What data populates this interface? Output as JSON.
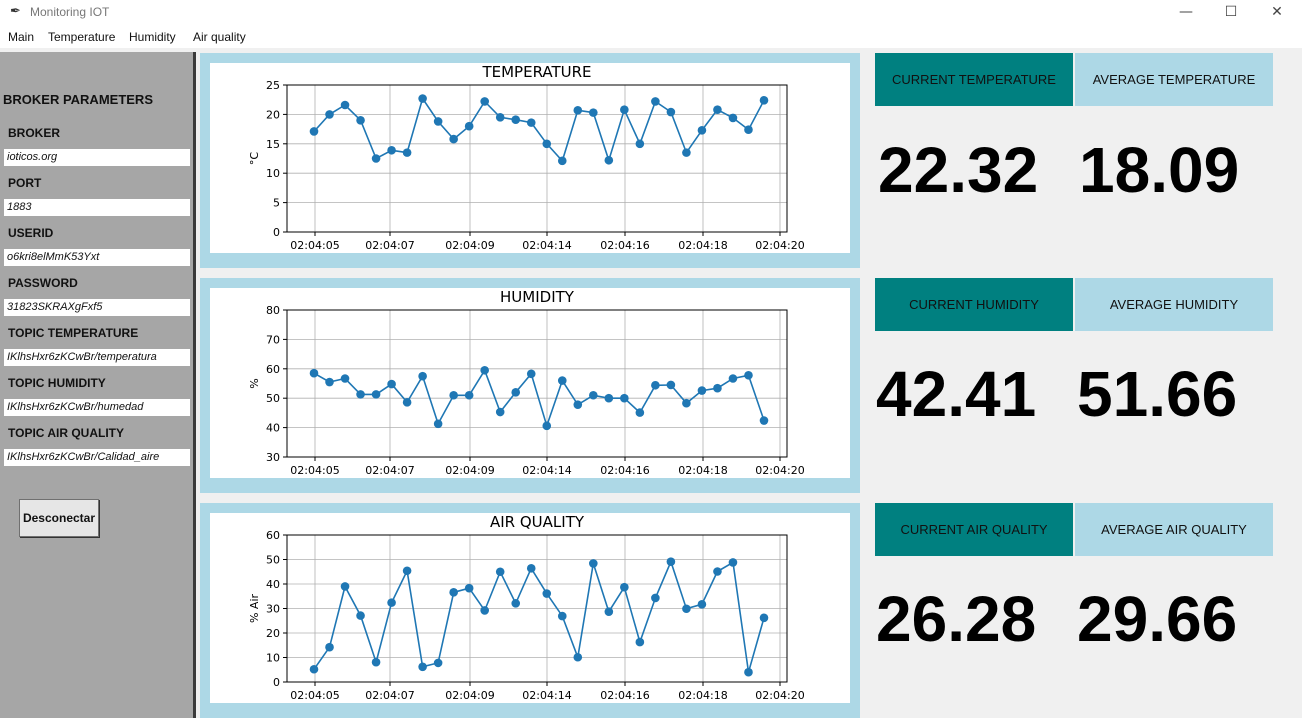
{
  "window": {
    "title": "Monitoring IOT",
    "icon": "feather-icon",
    "minimize": "—",
    "maximize": "☐",
    "close": "✕"
  },
  "menu": [
    "Main",
    "Temperature",
    "Humidity",
    "Air quality"
  ],
  "sidebar": {
    "title": "BROKER PARAMETERS",
    "fields": [
      {
        "label": "BROKER",
        "value": "ioticos.org"
      },
      {
        "label": "PORT",
        "value": "1883"
      },
      {
        "label": "USERID",
        "value": "o6kri8elMmK53Yxt"
      },
      {
        "label": "PASSWORD",
        "value": "31823SKRAXgFxf5"
      },
      {
        "label": "TOPIC TEMPERATURE",
        "value": "IKlhsHxr6zKCwBr/temperatura"
      },
      {
        "label": "TOPIC HUMIDITY",
        "value": "IKlhsHxr6zKCwBr/humedad"
      },
      {
        "label": "TOPIC AIR QUALITY",
        "value": "IKlhsHxr6zKCwBr/Calidad_aire"
      }
    ],
    "button": "Desconectar"
  },
  "cards": {
    "temperature": {
      "current_label": "CURRENT TEMPERATURE",
      "average_label": "AVERAGE TEMPERATURE",
      "current": "22.32",
      "average": "18.09"
    },
    "humidity": {
      "current_label": "CURRENT HUMIDITY",
      "average_label": "AVERAGE HUMIDITY",
      "current": "42.41",
      "average": "51.66"
    },
    "air": {
      "current_label": "CURRENT AIR QUALITY",
      "average_label": "AVERAGE AIR QUALITY",
      "current": "26.28",
      "average": "29.66"
    }
  },
  "colors": {
    "teal": "#008080",
    "lightblue": "#add8e6",
    "sidebar": "#a6a6a6",
    "series": "#1f77b4",
    "grid": "#b0b0b0"
  },
  "chart_data": [
    {
      "type": "line",
      "title": "TEMPERATURE",
      "xlabel": "",
      "ylabel": "°C",
      "ylim": [
        0,
        25
      ],
      "yticks": [
        0,
        5,
        10,
        15,
        20,
        25
      ],
      "xlim": [
        "02:04:04.57",
        "02:04:20.37"
      ],
      "xticks": [
        "02:04:05",
        "02:04:07",
        "02:04:09",
        "02:04:14",
        "02:04:16",
        "02:04:18",
        "02:04:20"
      ],
      "grid": true,
      "x": [
        "02:04:05",
        "02:04:05.5",
        "02:04:06",
        "02:04:06.5",
        "02:04:07",
        "02:04:07.5",
        "02:04:07.9",
        "02:04:08.4",
        "02:04:08.9",
        "02:04:09",
        "02:04:09.5",
        "02:04:10",
        "02:04:12",
        "02:04:13",
        "02:04:14",
        "02:04:14.5",
        "02:04:15",
        "02:04:15.5",
        "02:04:16",
        "02:04:16.4",
        "02:04:16.9",
        "02:04:17.4",
        "02:04:17.8",
        "02:04:18",
        "02:04:18.3",
        "02:04:18.8",
        "02:04:19.2",
        "02:04:19.7",
        "02:04:20"
      ],
      "series": [
        {
          "values": [
            17.1,
            20.0,
            21.6,
            19.0,
            12.5,
            13.9,
            13.5,
            22.7,
            18.8,
            15.8,
            18.0,
            22.2,
            19.5,
            19.1,
            18.6,
            15.0,
            12.1,
            20.7,
            20.3,
            12.2,
            20.8,
            15.0,
            22.2,
            20.4,
            13.5,
            17.3,
            20.8,
            19.4,
            17.4,
            22.4
          ]
        }
      ]
    },
    {
      "type": "line",
      "title": "HUMIDITY",
      "xlabel": "",
      "ylabel": "%",
      "ylim": [
        30,
        80
      ],
      "yticks": [
        30,
        40,
        50,
        60,
        70,
        80
      ],
      "xticks": [
        "02:04:05",
        "02:04:07",
        "02:04:09",
        "02:04:14",
        "02:04:16",
        "02:04:18",
        "02:04:20"
      ],
      "grid": true,
      "series": [
        {
          "values": [
            58.5,
            55.5,
            56.7,
            51.3,
            51.3,
            54.8,
            48.6,
            57.5,
            41.3,
            51.0,
            51.0,
            59.5,
            45.3,
            52.0,
            58.3,
            40.6,
            56.0,
            47.8,
            51.0,
            50.0,
            50.0,
            45.1,
            54.4,
            54.5,
            48.3,
            52.6,
            53.4,
            56.7,
            57.8,
            42.4
          ]
        }
      ]
    },
    {
      "type": "line",
      "title": "AIR QUALITY",
      "xlabel": "",
      "ylabel": "% Air",
      "ylim": [
        0,
        60
      ],
      "yticks": [
        0,
        10,
        20,
        30,
        40,
        50,
        60
      ],
      "xticks": [
        "02:04:05",
        "02:04:07",
        "02:04:09",
        "02:04:14",
        "02:04:16",
        "02:04:18",
        "02:04:20"
      ],
      "grid": true,
      "series": [
        {
          "values": [
            5.2,
            14.2,
            39.0,
            27.1,
            8.1,
            32.4,
            45.4,
            6.2,
            7.8,
            36.6,
            38.3,
            29.2,
            45.0,
            32.1,
            46.4,
            36.1,
            26.9,
            10.1,
            48.4,
            28.7,
            38.7,
            16.3,
            34.3,
            49.1,
            29.9,
            31.7,
            45.1,
            48.8,
            4.0,
            26.2
          ]
        }
      ]
    }
  ]
}
